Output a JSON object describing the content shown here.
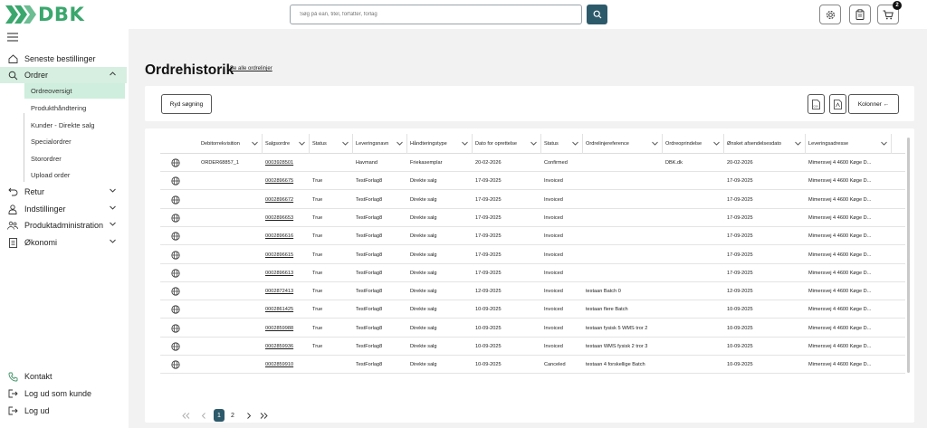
{
  "header": {
    "logo_text": "DBK",
    "search_placeholder": "Søg på ean, titel, forfatter, forlag",
    "cart_count": "2"
  },
  "sidebar": {
    "items": [
      {
        "label": "Seneste bestillinger",
        "icon": "home-icon"
      },
      {
        "label": "Ordrer",
        "icon": "search-icon",
        "expanded": true
      },
      {
        "label": "Retur",
        "icon": "return-arrow-icon"
      },
      {
        "label": "Indstillinger",
        "icon": "user-icon"
      },
      {
        "label": "Produktadministration",
        "icon": "users-icon"
      },
      {
        "label": "Økonomi",
        "icon": "document-icon"
      }
    ],
    "sub_items": [
      {
        "label": "Ordreoversigt",
        "active": true
      },
      {
        "label": "Produkthåndtering"
      },
      {
        "label": "Kunder - Direkte salg"
      },
      {
        "label": "Specialordrer"
      },
      {
        "label": "Storordrer"
      },
      {
        "label": "Upload order"
      }
    ],
    "bottom": [
      {
        "label": "Kontakt",
        "icon": "phone-icon"
      },
      {
        "label": "Log ud som kunde",
        "icon": "logout-icon"
      },
      {
        "label": "Log ud",
        "icon": "logout-icon"
      }
    ]
  },
  "main": {
    "title": "Ordrehistorik",
    "see_all_link": "Se alle ordrelinjer",
    "reset_button": "Ryd søgning",
    "columns_button": "Kolonner ←"
  },
  "table": {
    "columns": [
      "Debitorrekvisition",
      "Salgsordre",
      "Status",
      "Leveringsnavn",
      "Håndteringstype",
      "Dato for oprettelse",
      "Status",
      "Ordrelinjereference",
      "Ordreoprindelse",
      "Ønsket afsendelsesdato",
      "Leveringsadresse"
    ],
    "rows": [
      [
        "ORDER68857_1",
        "0003928501",
        "",
        "Havmand",
        "Friekasemplar",
        "20-02-2026",
        "Confirmed",
        "",
        "DBK.dk",
        "20-02-2026",
        "Mimersvej 4 4600 Køge D..."
      ],
      [
        "",
        "0002896675",
        "True",
        "TestForlag8",
        "Direkte salg",
        "17-09-2025",
        "Invoiced",
        "",
        "",
        "17-09-2025",
        "Mimersvej 4 4600 Køge D..."
      ],
      [
        "",
        "0002896672",
        "True",
        "TestForlag8",
        "Direkte salg",
        "17-09-2025",
        "Invoiced",
        "",
        "",
        "17-09-2025",
        "Mimersvej 4 4600 Køge D..."
      ],
      [
        "",
        "0002896653",
        "True",
        "TestForlag8",
        "Direkte salg",
        "17-09-2025",
        "Invoiced",
        "",
        "",
        "17-09-2025",
        "Mimersvej 4 4600 Køge D..."
      ],
      [
        "",
        "0002896616",
        "True",
        "TestForlag8",
        "Direkte salg",
        "17-09-2025",
        "Invoiced",
        "",
        "",
        "17-09-2025",
        "Mimersvej 4 4600 Køge D..."
      ],
      [
        "",
        "0002896615",
        "True",
        "TestForlag8",
        "Direkte salg",
        "17-09-2025",
        "Invoiced",
        "",
        "",
        "17-09-2025",
        "Mimersvej 4 4600 Køge D..."
      ],
      [
        "",
        "0002896613",
        "True",
        "TestForlag8",
        "Direkte salg",
        "17-09-2025",
        "Invoiced",
        "",
        "",
        "17-09-2025",
        "Mimersvej 4 4600 Køge D..."
      ],
      [
        "",
        "0002872413",
        "True",
        "TestForlag8",
        "Direkte salg",
        "12-09-2025",
        "Invoiced",
        "testaan Batch 0",
        "",
        "12-09-2025",
        "Mimersvej 4 4600 Køge D..."
      ],
      [
        "",
        "0002861425",
        "True",
        "TestForlag8",
        "Direkte salg",
        "10-09-2025",
        "Invoiced",
        "testaan flere Batch",
        "",
        "10-09-2025",
        "Mimersvej 4 4600 Køge D..."
      ],
      [
        "",
        "0002859988",
        "True",
        "TestForlag8",
        "Direkte salg",
        "10-09-2025",
        "Invoiced",
        "testaan fysisk 5 WMS tror 2",
        "",
        "10-09-2025",
        "Mimersvej 4 4600 Køge D..."
      ],
      [
        "",
        "0002859936",
        "True",
        "TestForlag8",
        "Direkte salg",
        "10-09-2025",
        "Invoiced",
        "testaan WMS fysisk 2 tror 3",
        "",
        "10-09-2025",
        "Mimersvej 4 4600 Køge D..."
      ],
      [
        "",
        "0002859910",
        "",
        "TestForlag8",
        "Direkte salg",
        "10-09-2025",
        "Canceled",
        "testaan 4 forskellige Batch",
        "",
        "10-09-2025",
        "Mimersvej 4 4600 Køge D..."
      ]
    ]
  },
  "pagination": {
    "pages": [
      "1",
      "2"
    ],
    "current": "1"
  },
  "colors": {
    "brand_green": "#3aa76d",
    "accent_teal": "#2d5a6b",
    "active_nav": "#d6efe0"
  }
}
